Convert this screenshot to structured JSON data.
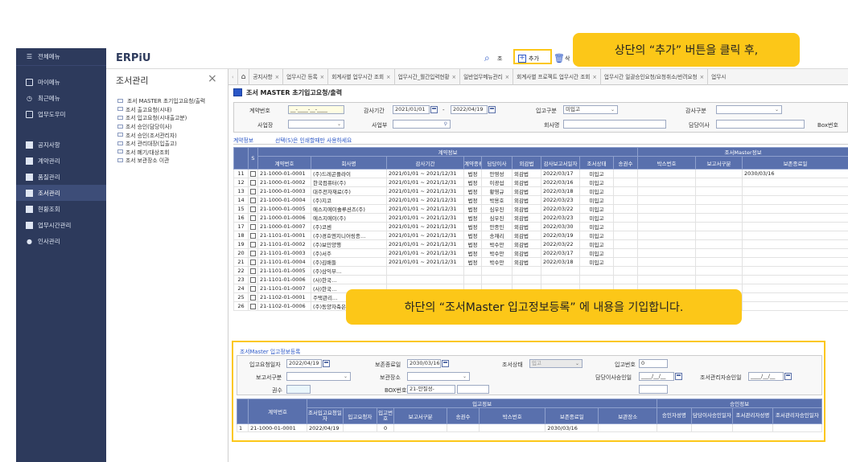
{
  "app": {
    "brand": "ERPiU",
    "menu_label": "전체메뉴",
    "module_title": "조서관리",
    "window_title": "조서 MASTER 초기입고요청/출력"
  },
  "nav": [
    {
      "label": "마이메뉴",
      "icon": "bookmark-icon"
    },
    {
      "label": "최근메뉴",
      "icon": "clock-icon"
    },
    {
      "label": "업무도우미",
      "icon": "square-icon"
    },
    {
      "label": "공지사항",
      "icon": "doc-icon"
    },
    {
      "label": "계약관리",
      "icon": "doc-icon"
    },
    {
      "label": "품질관리",
      "icon": "doc-icon"
    },
    {
      "label": "조서관리",
      "icon": "doc-icon"
    },
    {
      "label": "현황조회",
      "icon": "doc-icon"
    },
    {
      "label": "업무시간관리",
      "icon": "doc-icon"
    },
    {
      "label": "인사관리",
      "icon": "user-icon"
    }
  ],
  "toolbar": {
    "query_label": "조",
    "add_label": "추가",
    "delete_label": "삭"
  },
  "tree": [
    "조서 MASTER 초기입고요청/출력",
    "조서 출고요청(시내)",
    "조서 입고요청(시내출고분)",
    "조서 승인(담당이사)",
    "조서 승인(조서관리자)",
    "조서 관리대장(입출고)",
    "조서 폐기/대상조회",
    "조서 보관장소 이관"
  ],
  "tabs": [
    "공지사항",
    "업무시간 등록",
    "회계사별 업무시간 조회",
    "업무시간_월간입력현황",
    "일반업무메뉴관리",
    "회계사별 프로젝트 업무시간 조회",
    "업무시간 일괄승인요청/요청취소/반려요청",
    "업무시"
  ],
  "filters": {
    "contract_no_label": "계약번호",
    "contract_no_value": "__-____-__-____",
    "audit_period_label": "감사기간",
    "audit_from": "2021/01/01",
    "audit_to": "2022/04/19",
    "receipt_type_label": "입고구분",
    "receipt_type_value": "미입고",
    "audit_type_label": "감사구분",
    "business_site_label": "사업장",
    "division_label": "사업부",
    "company_label": "회사명",
    "director_label": "담당이사",
    "box_no_label": "Box번호"
  },
  "contract_tab_label": "계약정보",
  "hint": "선택(S)은 인쇄할때만 사용하세요",
  "grid": {
    "group_contract": "계약정보",
    "group_master": "조서Master정보",
    "headers": [
      "S",
      "계약번호",
      "회사명",
      "감사기간",
      "계약종류",
      "담당이사",
      "외감법",
      "감사보고서일자",
      "조서상태",
      "송권수",
      "박스번호",
      "보고서구분",
      "보존종료일"
    ],
    "rows": [
      [
        "11",
        "21-1000-01-0001",
        "(주)드레곤플라이",
        "2021/01/01 ~ 2021/12/31",
        "법정",
        "안영성",
        "외감법",
        "2022/03/17",
        "미입고",
        "",
        "",
        "",
        "2030/03/16"
      ],
      [
        "12",
        "21-1000-01-0002",
        "한국컴퓨터(주)",
        "2021/01/01 ~ 2021/12/31",
        "법정",
        "이광섭",
        "외감법",
        "2022/03/16",
        "미입고",
        "",
        "",
        "",
        ""
      ],
      [
        "13",
        "21-1000-01-0003",
        "대주전자재료(주)",
        "2021/01/01 ~ 2021/12/31",
        "법정",
        "황영규",
        "외감법",
        "2022/03/18",
        "미입고",
        "",
        "",
        "",
        ""
      ],
      [
        "14",
        "21-1000-01-0004",
        "(주)지코",
        "2021/01/01 ~ 2021/12/31",
        "법정",
        "박용호",
        "외감법",
        "2022/03/23",
        "미입고",
        "",
        "",
        "",
        ""
      ],
      [
        "15",
        "21-1000-01-0005",
        "에스지에이솔루션즈(주)",
        "2021/01/01 ~ 2021/12/31",
        "법정",
        "심우진",
        "외감법",
        "2022/03/22",
        "미입고",
        "",
        "",
        "",
        ""
      ],
      [
        "16",
        "21-1000-01-0006",
        "에스지에이(주)",
        "2021/01/01 ~ 2021/12/31",
        "법정",
        "심우진",
        "외감법",
        "2022/03/23",
        "미입고",
        "",
        "",
        "",
        ""
      ],
      [
        "17",
        "21-1000-01-0007",
        "(주)코센",
        "2021/01/01 ~ 2021/12/31",
        "법정",
        "안종인",
        "외감법",
        "2022/03/30",
        "미입고",
        "",
        "",
        "",
        ""
      ],
      [
        "18",
        "21-1101-01-0001",
        "(주)경호엔지니어링종…",
        "2021/01/01 ~ 2021/12/31",
        "법정",
        "송재리",
        "외감법",
        "2022/03/19",
        "미입고",
        "",
        "",
        "",
        ""
      ],
      [
        "19",
        "21-1101-01-0002",
        "(주)보민양행",
        "2021/01/01 ~ 2021/12/31",
        "법정",
        "박수만",
        "외감법",
        "2022/03/22",
        "미입고",
        "",
        "",
        "",
        ""
      ],
      [
        "20",
        "21-1101-01-0003",
        "(주)서주",
        "2021/01/01 ~ 2021/12/31",
        "법정",
        "박수만",
        "외감법",
        "2022/03/17",
        "미입고",
        "",
        "",
        "",
        ""
      ],
      [
        "21",
        "21-1101-01-0004",
        "(주)김배들",
        "2021/01/01 ~ 2021/12/31",
        "법정",
        "박수만",
        "외감법",
        "2022/03/18",
        "미입고",
        "",
        "",
        "",
        ""
      ],
      [
        "22",
        "21-1101-01-0005",
        "(주)삼익부…",
        "",
        "",
        "",
        "",
        "",
        "",
        "",
        "",
        "",
        ""
      ],
      [
        "23",
        "21-1101-01-0006",
        "(사)한국…",
        "",
        "",
        "",
        "",
        "",
        "",
        "",
        "",
        "",
        ""
      ],
      [
        "24",
        "21-1101-01-0007",
        "(사)한국…",
        "",
        "",
        "",
        "",
        "",
        "",
        "",
        "",
        "",
        ""
      ],
      [
        "25",
        "21-1102-01-0001",
        "주택관리…",
        "",
        "",
        "",
        "",
        "",
        "",
        "",
        "",
        "",
        ""
      ],
      [
        "26",
        "21-1102-01-0006",
        "(주)동양자축은행",
        "2021/01/01 ~ 2021/12/31",
        "법정",
        "송재리",
        "외감법",
        "",
        "미입고",
        "",
        "",
        "",
        ""
      ]
    ]
  },
  "entry": {
    "title": "조서Master 입고정보등록",
    "req_date_label": "입고요청일자",
    "req_date_value": "2022/04/19",
    "keep_end_label": "보존종료일",
    "keep_end_value": "2030/03/16",
    "status_label": "조서상태",
    "status_value": "입고",
    "receipt_no_label": "입고번호",
    "receipt_no_value": "0",
    "report_type_label": "보고서구분",
    "storage_label": "보관장소",
    "director_sign_label": "담당이사승인일",
    "director_sign_value": "____/__/__",
    "manager_sign_label": "조서관리자승인일",
    "manager_sign_value": "____/__/__",
    "volumes_label": "권수",
    "box_no_label": "BOX번호",
    "box_no_value": "21-안질성-"
  },
  "entry_grid": {
    "group_receipt": "입고정보",
    "group_approval": "승인정보",
    "headers": [
      "계약번호",
      "조서입고요청일자",
      "입고요청자",
      "입고번호",
      "보고서구분",
      "송권수",
      "박스번호",
      "보존종료일",
      "보관장소",
      "승인자성명",
      "담당이사승인일자",
      "조서관리자성명",
      "조서관리자승인일자"
    ],
    "rows": [
      [
        "1",
        "21-1000-01-0001",
        "2022/04/19",
        "",
        "0",
        "",
        "",
        "",
        "2030/03/16",
        "",
        "",
        "",
        "",
        ""
      ]
    ]
  },
  "callouts": {
    "top": "상단의 “추가” 버튼을 클릭 후,",
    "bottom": "하단의 “조서Master 입고정보등록” 에 내용을 기입합니다."
  },
  "colors": {
    "nav_bg": "#2d3a5c",
    "grid_header": "#5970ad",
    "callout": "#fcc718",
    "selection": "#2a56c6"
  }
}
